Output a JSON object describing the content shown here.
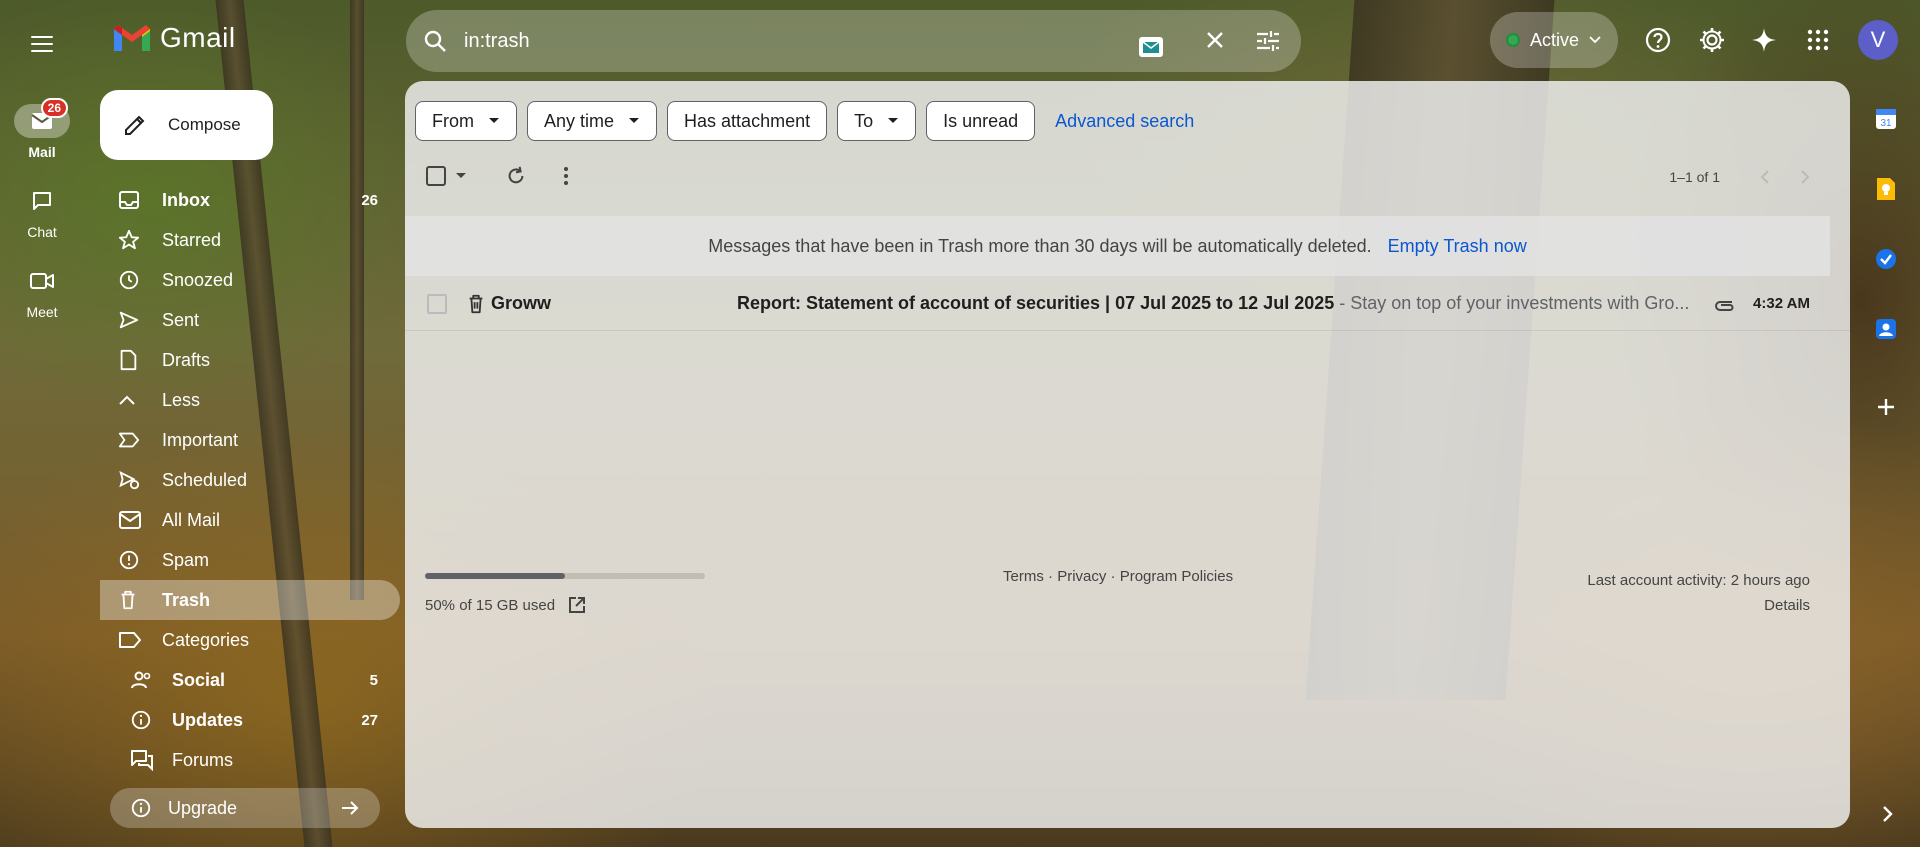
{
  "app": {
    "logo_text": "Gmail"
  },
  "rail": {
    "mail": {
      "label": "Mail",
      "badge": "26"
    },
    "chat": {
      "label": "Chat"
    },
    "meet": {
      "label": "Meet"
    }
  },
  "search": {
    "value": "in:trash"
  },
  "status": {
    "label": "Active"
  },
  "account": {
    "avatar_letter": "V"
  },
  "compose": {
    "label": "Compose"
  },
  "nav": {
    "items": [
      {
        "label": "Inbox",
        "count": "26",
        "icon": "inbox-icon"
      },
      {
        "label": "Starred",
        "count": "",
        "icon": "star-icon"
      },
      {
        "label": "Snoozed",
        "count": "",
        "icon": "clock-icon"
      },
      {
        "label": "Sent",
        "count": "",
        "icon": "send-icon"
      },
      {
        "label": "Drafts",
        "count": "",
        "icon": "draft-icon"
      },
      {
        "label": "Less",
        "count": "",
        "icon": "chevron-up-icon"
      },
      {
        "label": "Important",
        "count": "",
        "icon": "important-icon"
      },
      {
        "label": "Scheduled",
        "count": "",
        "icon": "scheduled-icon"
      },
      {
        "label": "All Mail",
        "count": "",
        "icon": "all-mail-icon"
      },
      {
        "label": "Spam",
        "count": "",
        "icon": "spam-icon"
      },
      {
        "label": "Trash",
        "count": "",
        "icon": "trash-icon"
      },
      {
        "label": "Categories",
        "count": "",
        "icon": "label-icon"
      }
    ],
    "categories": [
      {
        "label": "Social",
        "count": "5",
        "icon": "people-icon"
      },
      {
        "label": "Updates",
        "count": "27",
        "icon": "info-icon"
      },
      {
        "label": "Forums",
        "count": "",
        "icon": "forum-icon"
      }
    ],
    "upgrade_label": "Upgrade"
  },
  "filters": {
    "from": "From",
    "any_time": "Any time",
    "has_attachment": "Has attachment",
    "to": "To",
    "is_unread": "Is unread",
    "advanced": "Advanced search"
  },
  "pager": {
    "range": "1–1 of 1"
  },
  "notice": {
    "text": "Messages that have been in Trash more than 30 days will be automatically deleted.",
    "action": "Empty Trash now"
  },
  "messages": [
    {
      "sender": "Groww",
      "subject": "Report: Statement of account of securities | 07 Jul 2025 to 12 Jul 2025",
      "snippet": " - Stay on top of your investments with Gro...",
      "time": "4:32 AM",
      "has_attachment": true
    }
  ],
  "storage": {
    "text": "50% of 15 GB used",
    "fraction": 0.5
  },
  "footer": {
    "terms": "Terms",
    "privacy": "Privacy",
    "policies": "Program Policies",
    "sep": " · ",
    "activity": "Last account activity: 2 hours ago",
    "details": "Details"
  },
  "colors": {
    "accent": "#0b57d0",
    "badge": "#d93025",
    "avatar": "#5b5fc7"
  }
}
